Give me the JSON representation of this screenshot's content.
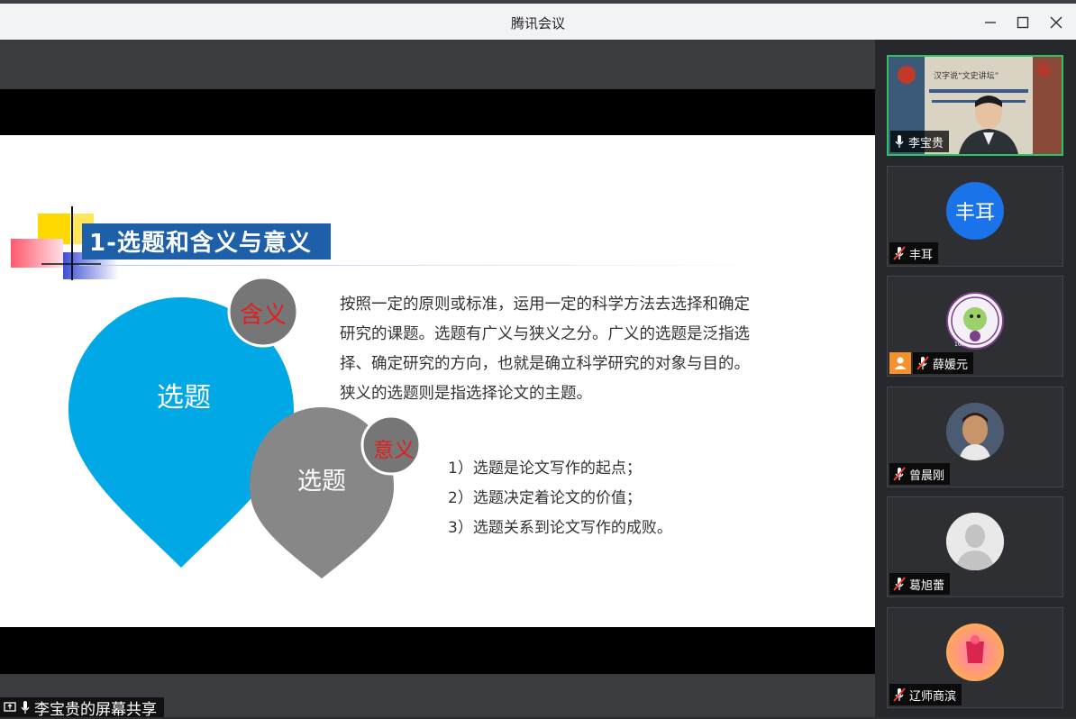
{
  "window": {
    "title": "腾讯会议"
  },
  "slide": {
    "heading": "1-选题和含义与意义",
    "drop_big_label": "选题",
    "drop_small_label": "选题",
    "circle_top_label": "含义",
    "circle_bottom_label": "意义",
    "paragraph": "按照一定的原则或标准，运用一定的科学方法去选择和确定研究的课题。选题有广义与狭义之分。广义的选题是泛指选择、确定研究的方向，也就是确立科学研究的对象与目的。狭义的选题则是指选择论文的主题。",
    "list": [
      "1）选题是论文写作的起点；",
      "2）选题决定着论文的价值；",
      "3）选题关系到论文写作的成败。"
    ],
    "colors": {
      "drop_blue": "#00a8e6",
      "drop_gray": "#878787",
      "heading_blue": "#1d5fa8",
      "circle_text_red": "#e41e1e"
    }
  },
  "share_label": "李宝贵的屏幕共享",
  "participants": [
    {
      "name": "李宝贵",
      "mic": "on",
      "video": true,
      "banner_text": "汉字说“文史讲坛”"
    },
    {
      "name": "丰耳",
      "mic": "muted",
      "avatar_text": "丰耳",
      "avatar_color": "#1a73e8"
    },
    {
      "name": "薛媛元",
      "mic": "muted",
      "avatar_text": "NANKAI UNIVERSITY",
      "avatar_badge": "100",
      "extra_icon": "user-icon"
    },
    {
      "name": "曾晨刚",
      "mic": "muted",
      "avatar_type": "photo"
    },
    {
      "name": "葛旭蕾",
      "mic": "muted",
      "avatar_type": "default-silhouette"
    },
    {
      "name": "辽师商滨",
      "mic": "muted",
      "avatar_type": "photo-pink"
    }
  ]
}
